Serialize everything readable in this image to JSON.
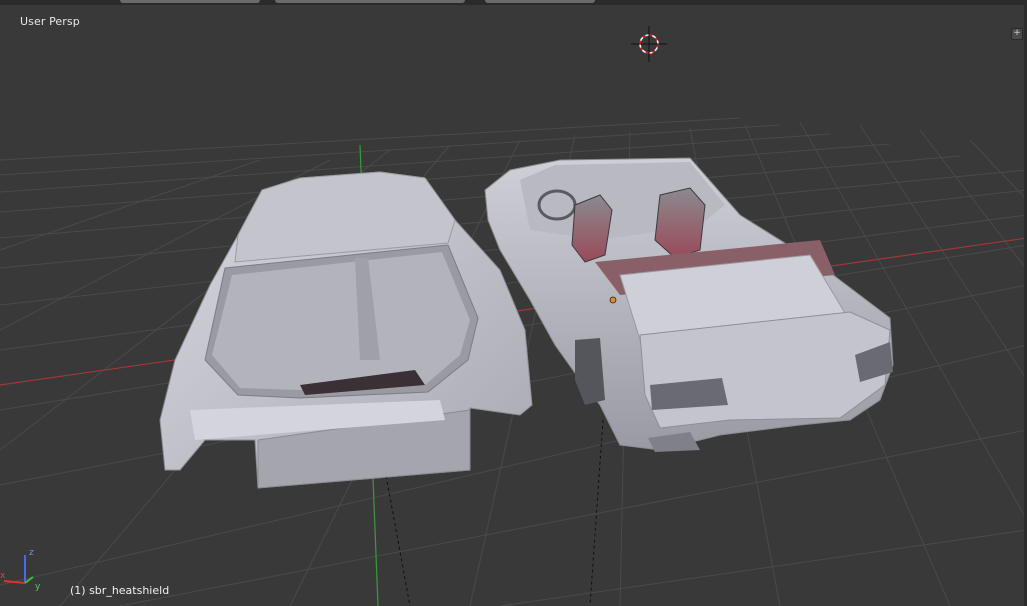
{
  "viewport": {
    "label": "User Persp",
    "object_info": "(1) sbr_heatshield",
    "expand_icon": "plus-icon"
  },
  "gizmo": {
    "z_label": "z",
    "y_label": "y",
    "x_label": "x"
  },
  "colors": {
    "background": "#393939",
    "grid": "#4a4a4a",
    "x_axis": "#a03838",
    "y_axis": "#3a9a3a",
    "mesh": "#c8c8d0",
    "cursor": "#d03030"
  }
}
